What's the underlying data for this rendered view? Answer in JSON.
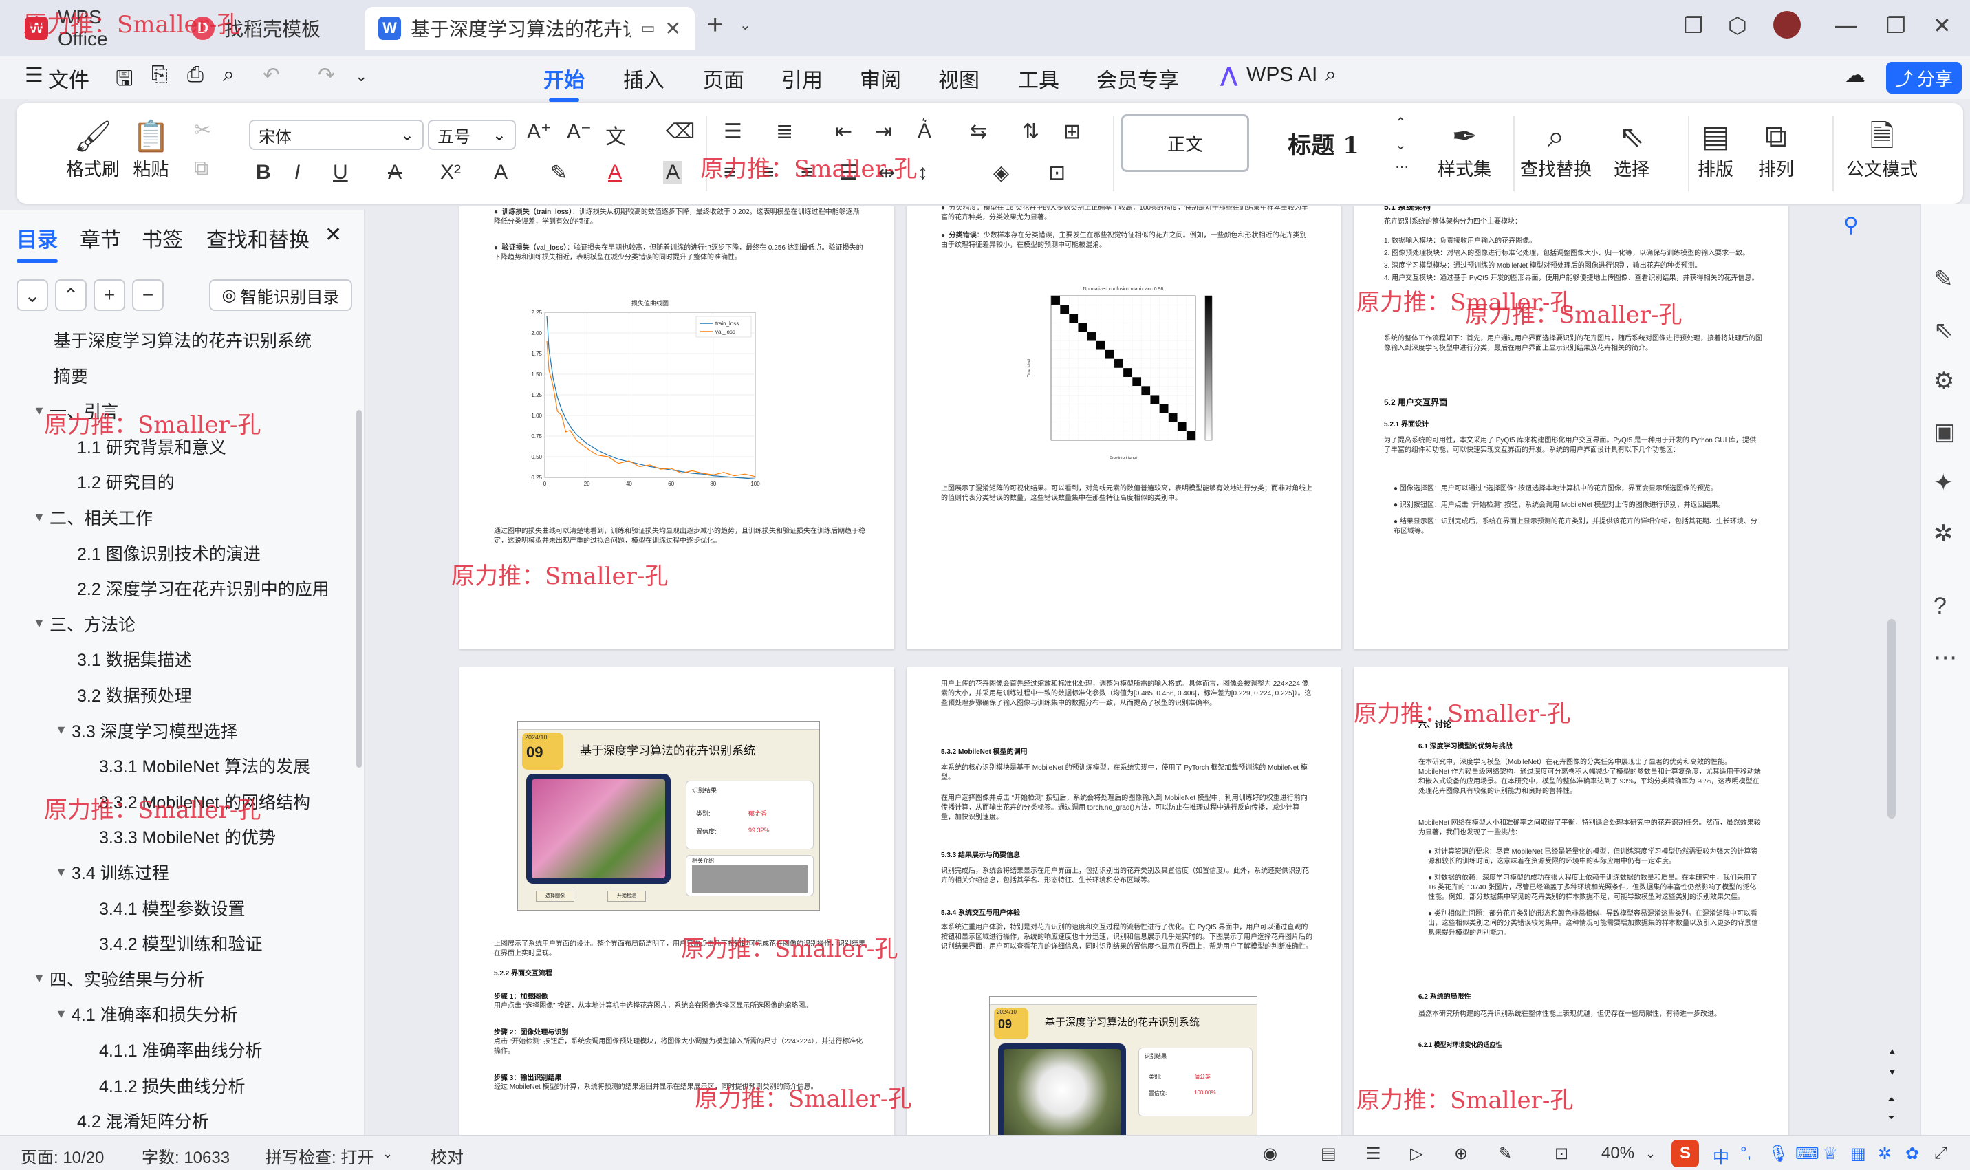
{
  "window": {
    "tabs": [
      {
        "label": "WPS Office",
        "icon": "wps-logo-icon"
      },
      {
        "label": "找稻壳模板",
        "icon": "docer-icon"
      },
      {
        "label": "基于深度学习算法的花卉识别系",
        "icon": "word-doc-icon"
      }
    ],
    "new_tab": "+"
  },
  "menubar": {
    "file": "文件",
    "items": [
      "开始",
      "插入",
      "页面",
      "引用",
      "审阅",
      "视图",
      "工具",
      "会员专享"
    ],
    "active": "开始",
    "wps_ai": "WPS AI",
    "share": "分享"
  },
  "ribbon": {
    "format_painter": "格式刷",
    "paste": "粘贴",
    "font_name": "宋体",
    "font_size": "五号",
    "style_normal": "正文",
    "style_heading": "标题 1",
    "style_set": "样式集",
    "find_replace": "查找替换",
    "select": "选择",
    "layout": "排版",
    "arrange": "排列",
    "official_mode": "公文模式"
  },
  "nav": {
    "tabs": [
      "目录",
      "章节",
      "书签",
      "查找和替换"
    ],
    "active_tab": "目录",
    "smart_toc": "智能识别目录",
    "toc": [
      {
        "label": "基于深度学习算法的花卉识别系统",
        "level": 0,
        "arrow": ""
      },
      {
        "label": "摘要",
        "level": 0,
        "arrow": ""
      },
      {
        "label": "一、引言",
        "level": 0,
        "arrow": "▼"
      },
      {
        "label": "1.1 研究背景和意义",
        "level": 1,
        "arrow": ""
      },
      {
        "label": "1.2 研究目的",
        "level": 1,
        "arrow": ""
      },
      {
        "label": "二、相关工作",
        "level": 0,
        "arrow": "▼"
      },
      {
        "label": "2.1 图像识别技术的演进",
        "level": 1,
        "arrow": ""
      },
      {
        "label": "2.2 深度学习在花卉识别中的应用",
        "level": 1,
        "arrow": ""
      },
      {
        "label": "三、方法论",
        "level": 0,
        "arrow": "▼"
      },
      {
        "label": "3.1 数据集描述",
        "level": 1,
        "arrow": ""
      },
      {
        "label": "3.2 数据预处理",
        "level": 1,
        "arrow": ""
      },
      {
        "label": "3.3 深度学习模型选择",
        "level": 1,
        "arrow": "▼"
      },
      {
        "label": "3.3.1 MobileNet 算法的发展",
        "level": 2,
        "arrow": ""
      },
      {
        "label": "3.3.2 MobileNet 的网络结构",
        "level": 2,
        "arrow": ""
      },
      {
        "label": "3.3.3 MobileNet 的优势",
        "level": 2,
        "arrow": ""
      },
      {
        "label": "3.4 训练过程",
        "level": 1,
        "arrow": "▼"
      },
      {
        "label": "3.4.1 模型参数设置",
        "level": 2,
        "arrow": ""
      },
      {
        "label": "3.4.2 模型训练和验证",
        "level": 2,
        "arrow": ""
      },
      {
        "label": "四、实验结果与分析",
        "level": 0,
        "arrow": "▼"
      },
      {
        "label": "4.1 准确率和损失分析",
        "level": 1,
        "arrow": "▼"
      },
      {
        "label": "4.1.1 准确率曲线分析",
        "level": 2,
        "arrow": ""
      },
      {
        "label": "4.1.2 损失曲线分析",
        "level": 2,
        "arrow": ""
      },
      {
        "label": "4.2 混淆矩阵分析",
        "level": 1,
        "arrow": ""
      }
    ]
  },
  "watermark": "原力推：Smaller-孔",
  "pages": {
    "p1": {
      "b1_title": "训练损失（train_loss）",
      "b1_text": "：训练损失从初期较高的数值逐步下降，最终收敛于 0.202。这表明模型在训练过程中能够逐渐降低分类误差，学到有效的特征。",
      "b2_title": "验证损失（val_loss）",
      "b2_text": "：验证损失在早期也较高，但随着训练的进行也逐步下降，最终在 0.256 达到最低点。验证损失的下降趋势和训练损失相近，表明模型在减少分类错误的同时提升了整体的准确性。",
      "chart_title": "损失值曲线图",
      "after": "通过图中的损失曲线可以清楚地看到，训练和验证损失均显现出逐步减小的趋势，且训练损失和验证损失在训练后期趋于稳定，这说明模型并未出现严重的过拟合问题，模型在训练过程中逐步优化。"
    },
    "p2": {
      "top": "分类精度：模型在 16 类花卉中的大多数类别上正确率了较高，100%的精度，特别是对于那些在训练集中样本量较为丰富的花卉种类，分类效果尤为显著。",
      "b_title": "分类错误",
      "b_text": "：少数样本存在分类错误，主要发生在那些视觉特征相似的花卉之间。例如，一些颜色和形状相近的花卉类别由于纹理特征差异较小，在模型的预测中可能被混淆。",
      "cm_title": "Normalized confusion matrix acc:0.98",
      "x_label": "Predicted label",
      "y_label": "True label",
      "after": "上图展示了混淆矩阵的可视化结果。可以看到，对角线元素的数值普遍较高，表明模型能够有效地进行分类；而非对角线上的值则代表分类错误的数量，这些错误数量集中在那些特征高度相似的类别中。"
    },
    "p3": {
      "h1": "5.1 系统架构",
      "intro": "花卉识别系统的整体架构分为四个主要模块：",
      "items": [
        "1. 数据输入模块：负责接收用户输入的花卉图像。",
        "2. 图像预处理模块：对输入的图像进行标准化处理，包括调整图像大小、归一化等，以确保与训练模型的输入要求一致。",
        "3. 深度学习模型模块：通过预训练的 MobileNet 模型对预处理后的图像进行识别，输出花卉的种类预测。",
        "4. 用户交互模块：通过基于 PyQt5 开发的图形界面，使用户能够便捷地上传图像、查看识别结果，并获得相关的花卉信息。"
      ],
      "flow": "系统的整体工作流程如下：首先，用户通过用户界面选择要识别的花卉图片，随后系统对图像进行预处理，接着将处理后的图像输入到深度学习模型中进行分类，最后在用户界面上显示识别结果及花卉相关的简介。",
      "h2": "5.2 用户交互界面",
      "h3": "5.2.1 界面设计",
      "p1": "为了提高系统的可用性，本文采用了 PyQt5 库来构建图形化用户交互界面。PyQt5 是一种用于开发的 Python GUI 库，提供了丰富的组件和功能，可以快速实现交互界面的开发。系统的用户界面设计具有以下几个功能区：",
      "bullets": [
        "图像选择区：用户可以通过 “选择图像” 按钮选择本地计算机中的花卉图像，界面会显示所选图像的预览。",
        "识别按钮区：用户点击 “开始检测” 按钮，系统会调用 MobileNet 模型对上传的图像进行识别，并返回结果。",
        "结果显示区：识别完成后，系统在界面上显示预测的花卉类别，并提供该花卉的详细介绍，包括其花期、生长环境、分布区域等。"
      ]
    },
    "p4": {
      "app_title": "基于深度学习算法的花卉识别系统",
      "date_badge": "2024/10",
      "date_day": "09",
      "result_header": "识别结果",
      "class_label": "类别:",
      "class_value": "郁金香",
      "conf_label": "置信度:",
      "conf_value": "99.32%",
      "intro_header": "相关介绍",
      "btn_select": "选择图像",
      "btn_detect": "开始检测",
      "caption": "上图展示了系统用户界面的设计。整个界面布局简洁明了，用户只需点击几下按钮即可完成花卉图像的识别操作，识别结果在界面上实时呈现。",
      "h1": "5.2.2 界面交互流程",
      "s1_title": "步骤 1：加载图像",
      "s1": "用户点击 “选择图像” 按钮，从本地计算机中选择花卉图片，系统会在图像选择区显示所选图像的缩略图。",
      "s2_title": "步骤 2：图像处理与识别",
      "s2": "点击 “开始检测” 按钮后，系统会调用图像预处理模块，将图像大小调整为模型输入所需的尺寸（224×224），并进行标准化操作。",
      "s3_title": "步骤 3：输出识别结果",
      "s3": "经过 MobileNet 模型的计算，系统将预测的结果返回并显示在结果展示区，同时提供预测类别的简介信息。"
    },
    "p5": {
      "top": "用户上传的花卉图像会首先经过缩放和标准化处理，调整为模型所需的输入格式。具体而言，图像会被调整为 224×224 像素的大小，并采用与训练过程中一致的数据标准化参数（均值为[0.485, 0.456, 0.406]，标准差为[0.229, 0.224, 0.225]）。这些预处理步骤确保了输入图像与训练集中的数据分布一致，从而提高了模型的识别准确率。",
      "h1": "5.3.2 MobileNet 模型的调用",
      "p1": "本系统的核心识别模块是基于 MobileNet 的预训练模型。在系统实现中，使用了 PyTorch 框架加载预训练的 MobileNet 模型。",
      "p2": "在用户选择图像并点击 “开始检测” 按钮后，系统会将处理后的图像输入到 MobileNet 模型中，利用训练好的权重进行前向传播计算，从而输出花卉的分类标签。通过调用 torch.no_grad()方法，可以防止在推理过程中进行反向传播，减少计算量，加快识别速度。",
      "h2": "5.3.3 结果展示与简要信息",
      "p3": "识别完成后，系统会将结果显示在用户界面上，包括识别出的花卉类别及其置信度（如置信度）。此外，系统还提供识别花卉的相关介绍信息，包括其学名、形态特征、生长环境和分布区域等。",
      "h3": "5.3.4 系统交互与用户体验",
      "p4": "本系统注重用户体验，特别是对花卉识别的速度和交互过程的流畅性进行了优化。在 PyQt5 界面中，用户可以通过直观的按钮和显示区域进行操作，系统的响应速度也十分迅速，识别和信息展示几乎是实时的。下图展示了用户选择花卉图片后的识别结果界面，用户可以查看花卉的详细信息，同时识别结果的置信度也显示在界面上，帮助用户了解模型的判断准确性。",
      "app_title": "基于深度学习算法的花卉识别系统",
      "date_badge": "2024/10",
      "date_day": "09",
      "result_header": "识别结果",
      "class_label": "类别:",
      "class_value": "蒲公英",
      "conf_label": "置信度:",
      "conf_value": "100.00%"
    },
    "p6": {
      "h1": "六、讨论",
      "h2": "6.1 深度学习模型的优势与挑战",
      "p1": "在本研究中，深度学习模型（MobileNet）在花卉图像的分类任务中展现出了显著的优势和高效的性能。MobileNet 作为轻量级网络架构，通过深度可分离卷积大幅减少了模型的参数量和计算复杂度，尤其适用于移动端和嵌入式设备的应用场景。在本研究中，模型的整体准确率达到了 93%，平均分类精确率为 98%，这表明模型在处理花卉图像具有较强的识别能力和良好的鲁棒性。",
      "p2": "MobileNet 网络在模型大小和准确率之间取得了平衡，特别适合处理本研究中的花卉识别任务。然而，虽然效果较为显著，我们也发现了一些挑战：",
      "bullets": [
        "对计算资源的要求：尽管 MobileNet 已经是轻量化的模型，但训练深度学习模型仍然需要较为强大的计算资源和较长的训练时间，这意味着在资源受限的环境中的实际应用中仍有一定难度。",
        "对数据的依赖：深度学习模型的成功在很大程度上依赖于训练数据的数量和质量。在本研究中，我们采用了 16 类花卉的 13740 张图片，尽管已经涵盖了多种环境和光照条件，但数据集的丰富性仍然影响了模型的泛化性能。例如，部分数据集中罕见的花卉类别的样本数据不足，可能导致模型对这些类别的识别效果欠佳。",
        "类别相似性问题：部分花卉类别的形态和颜色非常相似，导致模型容易混淆这些类别。在混淆矩阵中可以看出，这些相似类别之间的分类错误较为集中。这种情况可能需要增加数据集的样本数量以及引入更多的背景信息来提升模型的判别能力。"
      ],
      "h3": "6.2 系统的局限性",
      "p3": "虽然本研究所构建的花卉识别系统在整体性能上表现优越，但仍存在一些局限性，有待进一步改进。",
      "h4": "6.2.1 模型对环境变化的适应性"
    }
  },
  "status": {
    "page": "页面: 10/20",
    "words": "字数: 10633",
    "spell": "拼写检查: 打开",
    "proof": "校对",
    "zoom": "40%"
  },
  "chart_data": [
    {
      "type": "line",
      "title": "损失值曲线图",
      "xlabel": "",
      "ylabel": "",
      "xlim": [
        0,
        100
      ],
      "ylim": [
        0.25,
        2.25
      ],
      "x_ticks": [
        0,
        20,
        40,
        60,
        80,
        100
      ],
      "y_ticks": [
        0.25,
        0.5,
        0.75,
        1.0,
        1.25,
        1.5,
        1.75,
        2.0,
        2.25
      ],
      "legend_position": "top-right",
      "grid": true,
      "series": [
        {
          "name": "train_loss",
          "color": "#1f77b4",
          "x": [
            1,
            2,
            4,
            6,
            8,
            10,
            12,
            15,
            20,
            25,
            30,
            35,
            40,
            45,
            50,
            55,
            60,
            65,
            70,
            75,
            80,
            85,
            90,
            95,
            100
          ],
          "values": [
            2.2,
            1.8,
            1.45,
            1.22,
            1.07,
            0.96,
            0.87,
            0.77,
            0.66,
            0.58,
            0.52,
            0.47,
            0.44,
            0.41,
            0.38,
            0.36,
            0.34,
            0.32,
            0.3,
            0.29,
            0.27,
            0.26,
            0.25,
            0.24,
            0.23
          ]
        },
        {
          "name": "val_loss",
          "color": "#ff7f0e",
          "x": [
            1,
            2,
            4,
            6,
            8,
            10,
            12,
            15,
            20,
            25,
            30,
            35,
            40,
            45,
            50,
            55,
            60,
            65,
            70,
            75,
            80,
            85,
            90,
            95,
            100
          ],
          "values": [
            1.9,
            1.55,
            1.35,
            1.05,
            1.0,
            0.8,
            0.82,
            0.7,
            0.6,
            0.52,
            0.5,
            0.42,
            0.45,
            0.38,
            0.4,
            0.35,
            0.36,
            0.3,
            0.33,
            0.3,
            0.28,
            0.31,
            0.27,
            0.29,
            0.26
          ]
        }
      ]
    },
    {
      "type": "heatmap",
      "title": "Normalized confusion matrix acc:0.98",
      "xlabel": "Predicted label",
      "ylabel": "True label",
      "classes": 16,
      "diagonal_values": [
        0.98,
        0.97,
        0.99,
        0.98,
        0.96,
        0.99,
        0.98,
        0.97,
        0.99,
        0.98,
        0.97,
        0.99,
        0.98,
        0.96,
        0.99,
        0.98
      ],
      "colorscale": "greys"
    }
  ]
}
